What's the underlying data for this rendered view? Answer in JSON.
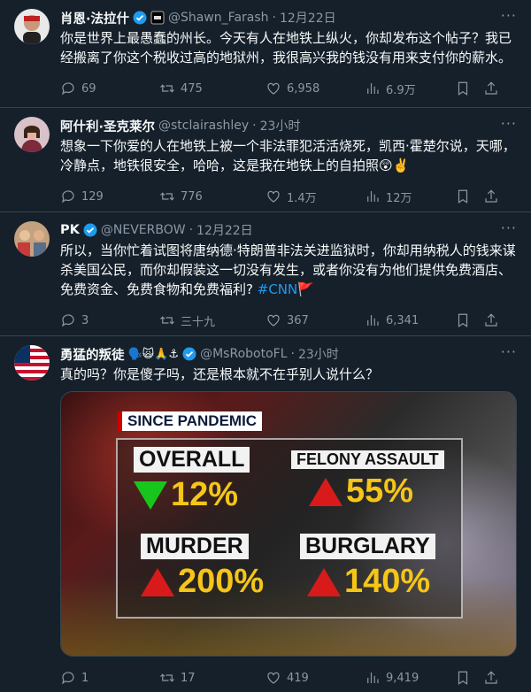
{
  "tweets": [
    {
      "name": "肖恩·法拉什",
      "handle": "@Shawn_Farash",
      "time": "12月22日",
      "text": "你是世界上最愚蠢的州长。今天有人在地铁上纵火，你却发布这个帖子？我已经搬离了你这个税收过高的地狱州，我很高兴我的钱没有用来支付你的薪水。",
      "replies": "69",
      "retweets": "475",
      "likes": "6,958",
      "views": "6.9万"
    },
    {
      "name": "阿什利·圣克莱尔",
      "handle": "@stclairashley",
      "time": "23小时",
      "text": "想象一下你爱的人在地铁上被一个非法罪犯活活烧死，凯西·霍楚尔说，天哪，冷静点，地铁很安全，哈哈，这是我在地铁上的自拍照😲✌️",
      "replies": "129",
      "retweets": "776",
      "likes": "1.4万",
      "views": "12万"
    },
    {
      "name": "PK",
      "handle": "@NEVERBOW",
      "time": "12月22日",
      "text": "所以，当你忙着试图将唐纳德·特朗普非法关进监狱时，你却用纳税人的钱来谋杀美国公民，而你却假装这一切没有发生，或者你没有为他们提供免费酒店、免费资金、免费食物和免费福利?",
      "hashtag": "#CNN",
      "flag": "🚩",
      "replies": "3",
      "retweets": "三十九",
      "likes": "367",
      "views": "6,341"
    },
    {
      "name": "勇猛的叛徒",
      "name_emoji": "🗣️🙀🙏⚓",
      "handle": "@MsRobotoFL",
      "time": "23小时",
      "text": "真的吗？你是傻子吗，还是根本就不在乎别人说什么？",
      "replies": "1",
      "retweets": "17",
      "likes": "419",
      "views": "9,419"
    }
  ],
  "media": {
    "banner": "SINCE PANDEMIC",
    "overall_label": "OVERALL",
    "overall_value": "12%",
    "felony_label": "FELONY ASSAULT",
    "felony_value": "55%",
    "murder_label": "MURDER",
    "murder_value": "200%",
    "burglary_label": "BURGLARY",
    "burglary_value": "140%"
  },
  "ui": {
    "dot": "·",
    "more": "···"
  },
  "colors": {
    "background": "#15202b",
    "text": "#f7f9f9",
    "muted": "#8b98a5",
    "accent": "#1d9bf0",
    "divider": "#38444d"
  }
}
